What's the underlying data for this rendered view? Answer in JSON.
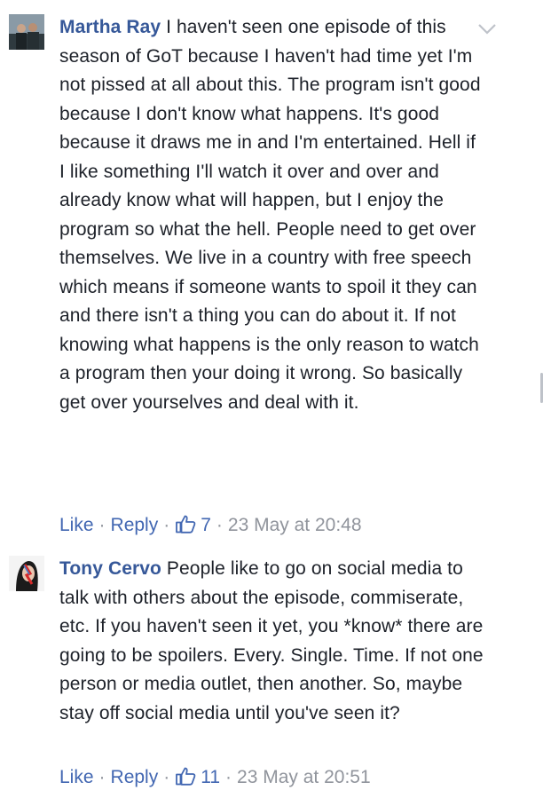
{
  "comments": [
    {
      "author": "Martha Ray",
      "text": "I haven't seen one episode of this season of GoT because I haven't had time yet I'm not pissed at all about this. The program isn't good because I don't know what happens. It's good because it draws me in and I'm entertained. Hell if I like something I'll watch it over and over and already know what will happen, but I enjoy the program so what the hell. People need to get over themselves. We live in a country with free speech which means if someone wants to spoil it they can and there isn't a thing you can do about it. If not knowing what happens is the only reason to watch a program then your doing it wrong. So basically get over yourselves and deal with it.",
      "like_label": "Like",
      "reply_label": "Reply",
      "like_count": "7",
      "timestamp": "23 May at 20:48"
    },
    {
      "author": "Tony Cervo",
      "text": "People like to go on social media to talk with others about the episode, commiserate, etc. If you haven't seen it yet, you *know* there are going to be spoilers. Every. Single. Time. If not one person or media outlet, then another. So, maybe stay off social media until you've seen it?",
      "like_label": "Like",
      "reply_label": "Reply",
      "like_count": "11",
      "timestamp": "23 May at 20:51"
    }
  ],
  "colors": {
    "link": "#4267b2",
    "author": "#365899",
    "meta": "#90949c",
    "text": "#1d2129"
  }
}
